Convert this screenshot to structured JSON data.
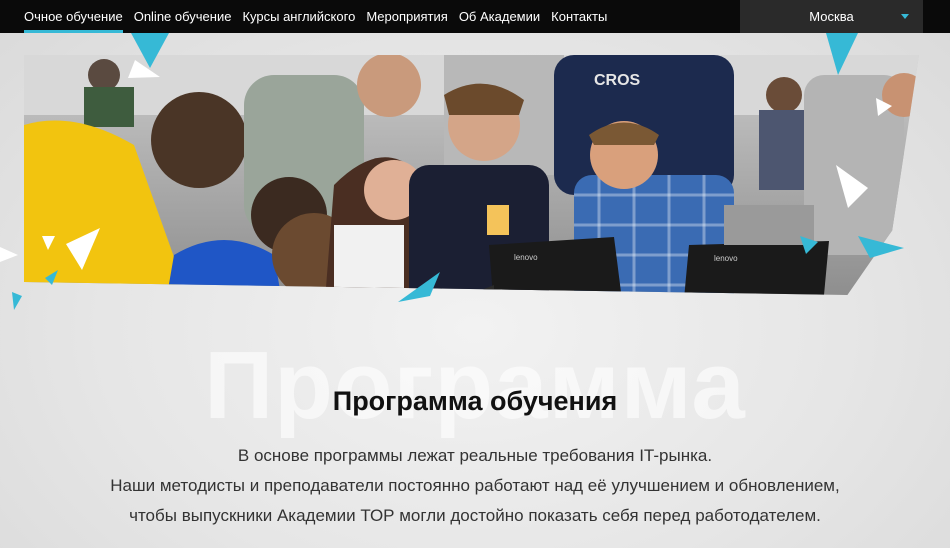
{
  "nav": {
    "items": [
      {
        "label": "Очное обучение",
        "active": true
      },
      {
        "label": "Online обучение",
        "active": false
      },
      {
        "label": "Курсы английского",
        "active": false
      },
      {
        "label": "Мероприятия",
        "active": false
      },
      {
        "label": "Об Академии",
        "active": false
      },
      {
        "label": "Контакты",
        "active": false
      }
    ],
    "city": "Москва",
    "city_icon": "chevron-down-icon"
  },
  "section": {
    "watermark": "Программа",
    "title": "Программа обучения",
    "lines": [
      "В основе программы лежат реальные требования IT-рынка.",
      "Наши методисты и преподаватели постоянно работают над её улучшением и обновлением,",
      "чтобы выпускники Академии ТОР могли достойно показать себя перед работодателем."
    ]
  },
  "colors": {
    "accent": "#36b9d6",
    "topbar": "#0a0a0a",
    "city_bg": "#2a2a2a"
  }
}
